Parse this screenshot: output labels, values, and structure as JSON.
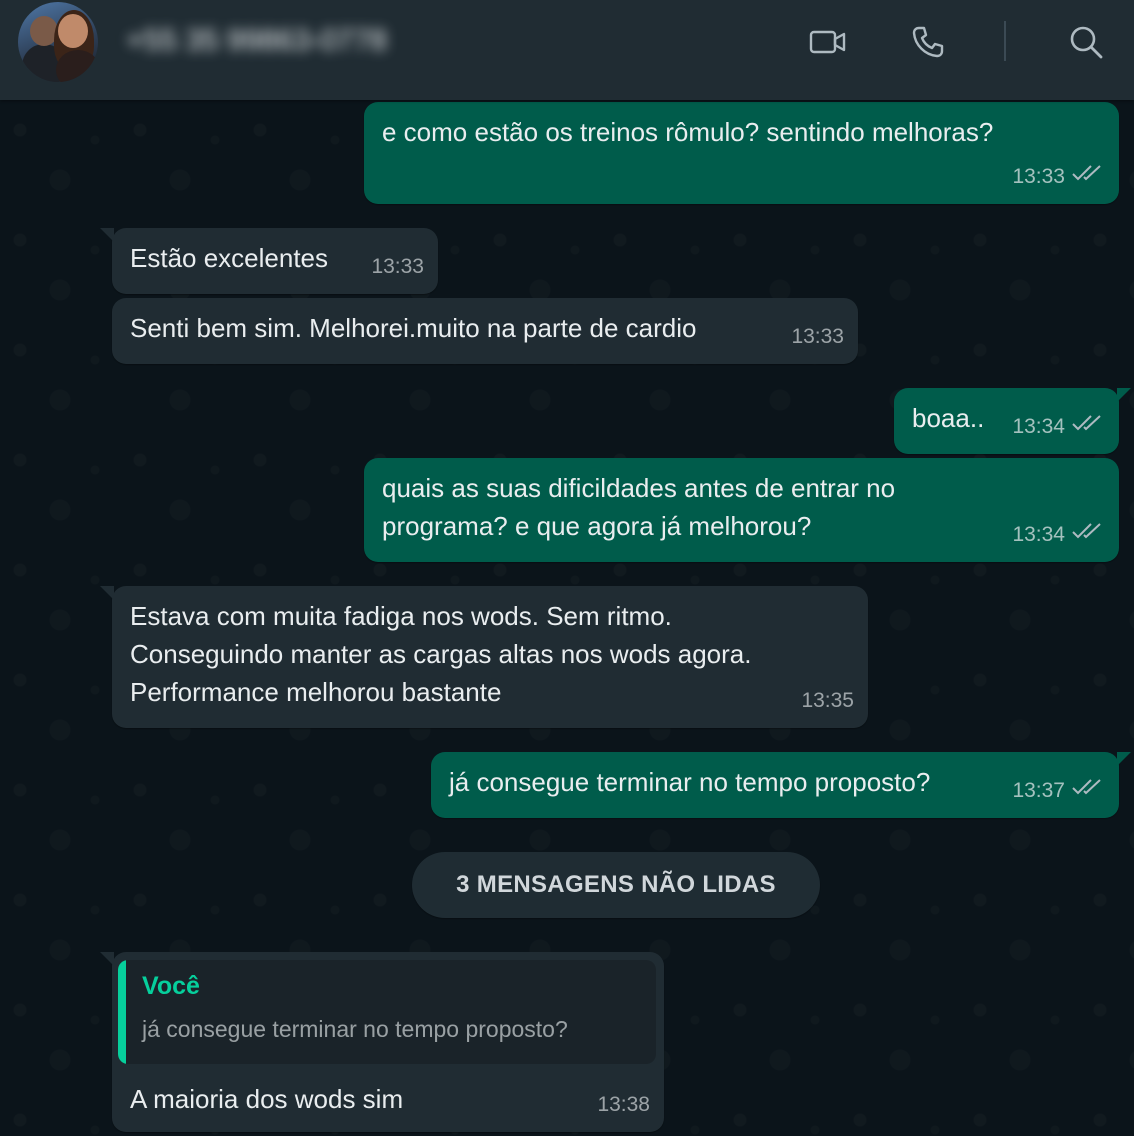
{
  "header": {
    "contact_name": "+55 35 99863-0778",
    "icons": [
      "video-call-icon",
      "voice-call-icon",
      "search-icon"
    ]
  },
  "colors": {
    "outgoing_bubble": "#005c4b",
    "incoming_bubble": "#202c33",
    "header": "#202c33",
    "background": "#0b141a",
    "accent": "#06cf9c"
  },
  "messages": [
    {
      "direction": "out",
      "lines": [
        "e como estão os treinos rômulo? sentindo melhoras?"
      ],
      "time": "13:33",
      "status": "read"
    },
    {
      "direction": "in",
      "lines": [
        "Estão excelentes"
      ],
      "time": "13:33"
    },
    {
      "direction": "in",
      "lines": [
        "Senti bem sim. Melhorei.muito na parte de cardio"
      ],
      "time": "13:33"
    },
    {
      "direction": "out",
      "lines": [
        "boaa.."
      ],
      "time": "13:34",
      "status": "read"
    },
    {
      "direction": "out",
      "lines": [
        "quais as suas dificildades antes de entrar no",
        "programa? e que agora já melhorou?"
      ],
      "time": "13:34",
      "status": "read"
    },
    {
      "direction": "in",
      "lines": [
        "Estava com muita fadiga nos wods. Sem ritmo.",
        "Conseguindo manter as cargas altas nos wods agora.",
        "Performance melhorou bastante"
      ],
      "time": "13:35"
    },
    {
      "direction": "out",
      "lines": [
        "já consegue terminar no tempo proposto?"
      ],
      "time": "13:37",
      "status": "read"
    }
  ],
  "unread_divider": "3 MENSAGENS NÃO LIDAS",
  "reply_message": {
    "direction": "in",
    "quote_author": "Você",
    "quote_text": "já consegue terminar no tempo proposto?",
    "text": "A maioria dos wods sim",
    "time": "13:38"
  }
}
